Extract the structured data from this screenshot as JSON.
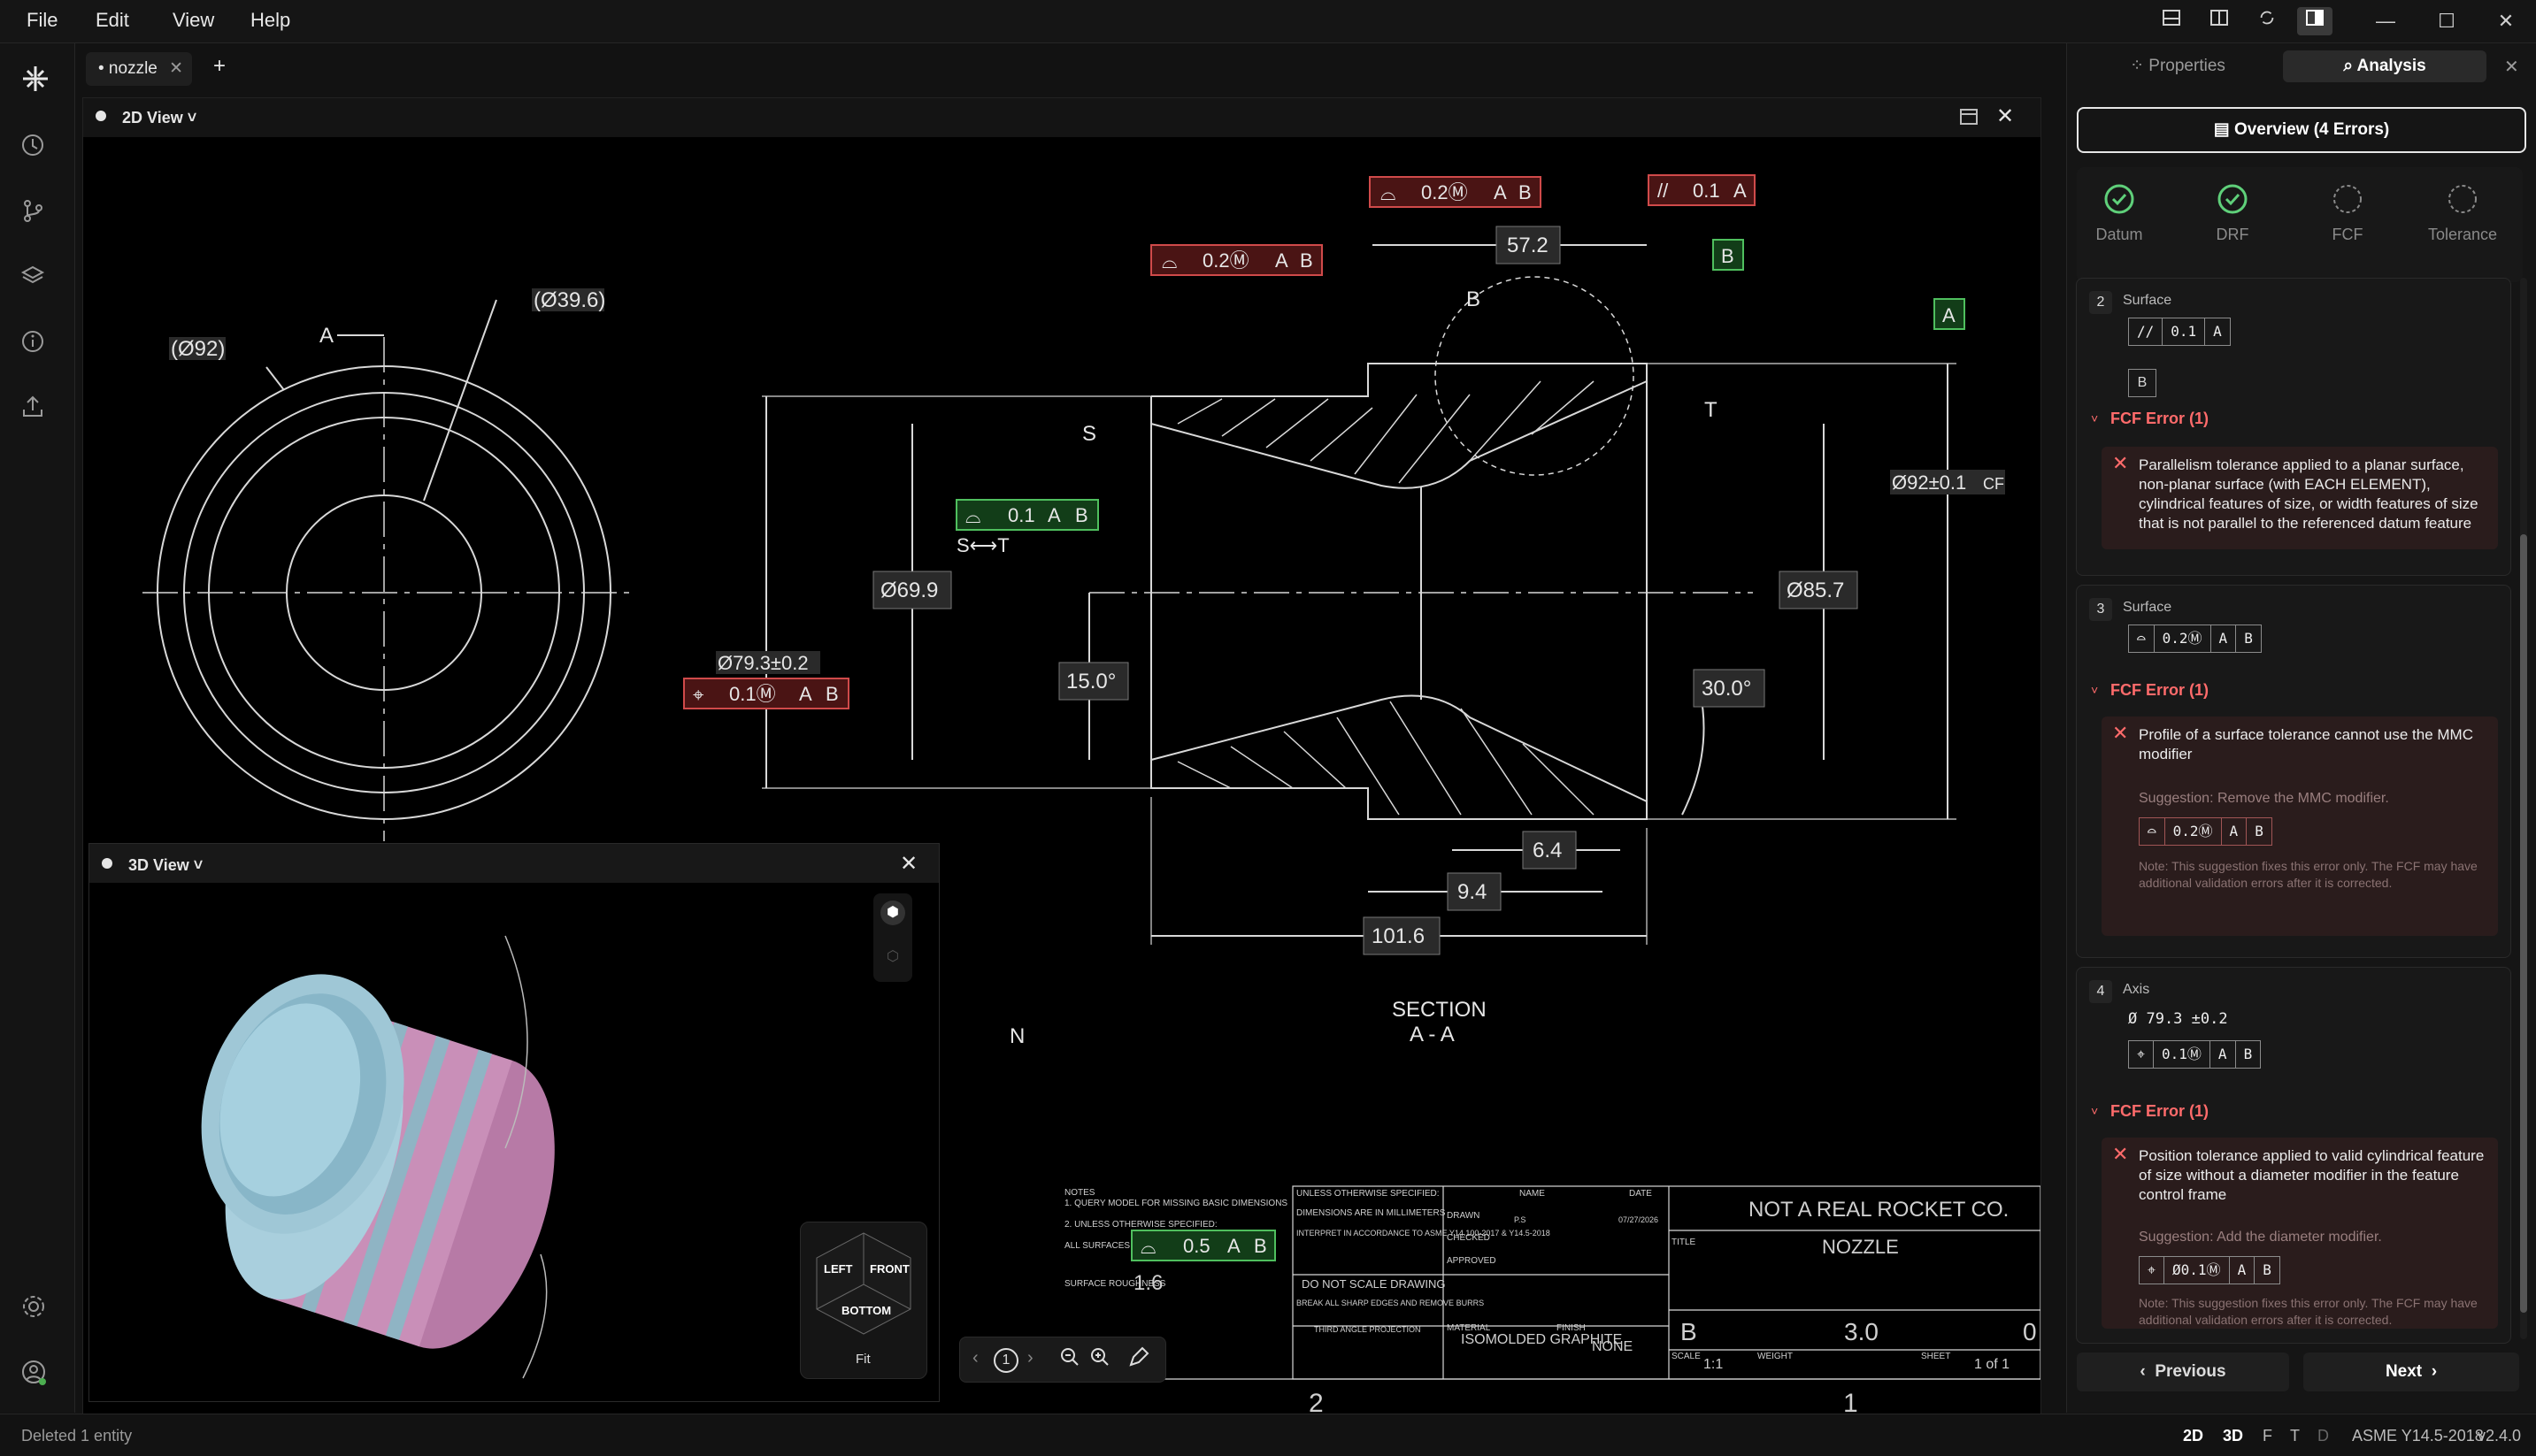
{
  "menu": {
    "file": "File",
    "edit": "Edit",
    "view": "View",
    "help": "Help"
  },
  "tabs": {
    "doc": "• nozzle",
    "add": "+"
  },
  "view2d": {
    "title": "2D View ˅"
  },
  "view3d": {
    "title": "3D View ˅",
    "cube": {
      "left": "LEFT",
      "front": "FRONT",
      "bottom": "BOTTOM",
      "fit": "Fit"
    }
  },
  "drawing": {
    "dims": {
      "d92": "(Ø92)",
      "d396": "(Ø39.6)",
      "a_label": "A",
      "s_label": "S",
      "t_label": "T",
      "b_label": "B",
      "n_label": "N",
      "d699": "Ø69.9",
      "d793": "Ø79.3±0.2",
      "d857": "Ø85.7",
      "d92tol": "Ø92±0.1",
      "cf": "CF",
      "ang15": "15.0°",
      "ang30": "30.0°",
      "d572": "57.2",
      "d64": "6.4",
      "d94": "9.4",
      "d1016": "101.6",
      "st": "S⟷T",
      "section": "SECTION",
      "section_sub": "A - A"
    },
    "fcf_top_left": {
      "tol": "0.2Ⓜ",
      "d1": "A",
      "d2": "B"
    },
    "fcf_top_mid": {
      "tol": "0.2Ⓜ",
      "d1": "A",
      "d2": "B"
    },
    "fcf_top_right": {
      "tol": "0.1",
      "d1": "A"
    },
    "fcf_green": {
      "tol": "0.1",
      "d1": "A",
      "d2": "B"
    },
    "fcf_position": {
      "tol": "0.1Ⓜ",
      "d1": "A",
      "d2": "B"
    },
    "datum_b": "B",
    "datum_a": "A",
    "title_block": {
      "notes_title": "NOTES",
      "note1": "1. QUERY MODEL FOR MISSING BASIC DIMENSIONS",
      "note2": "2. UNLESS OTHERWISE SPECIFIED:",
      "note2b": "ALL SURFACES",
      "surface_roughness": "SURFACE ROUGHNESS",
      "roughness_val": "1.6",
      "fcf_all": {
        "tol": "0.5",
        "d1": "A",
        "d2": "B"
      },
      "unless": "UNLESS OTHERWISE SPECIFIED:",
      "dims_mm": "DIMENSIONS ARE IN MILLIMETERS",
      "interpret": "INTERPRET IN ACCORDANCE TO ASME Y14.100-2017 & Y14.5-2018",
      "do_not_scale": "DO NOT SCALE DRAWING",
      "break_edges": "BREAK ALL SHARP EDGES AND REMOVE BURRS",
      "third_angle": "THIRD ANGLE PROJECTION",
      "name": "NAME",
      "date": "DATE",
      "drawn": "DRAWN",
      "checked": "CHECKED",
      "approved": "APPROVED",
      "drawn_name": "P.S",
      "drawn_date": "07/27/2026",
      "material": "MATERIAL",
      "material_val": "ISOMOLDED GRAPHITE",
      "finish": "FINISH",
      "finish_val": "NONE",
      "company": "NOT A REAL ROCKET CO.",
      "title_lbl": "TITLE",
      "title_val": "NOZZLE",
      "size_val": "B",
      "dwg_no": "3.0",
      "rev_val": "0",
      "scale_lbl": "SCALE",
      "scale_val": "1:1",
      "weight_lbl": "WEIGHT",
      "sheet_lbl": "SHEET",
      "sheet_val": "1 of 1",
      "zone2": "2",
      "zone1": "1"
    },
    "toolbar": {
      "page": "1"
    }
  },
  "right_panel": {
    "tab_properties": "Properties",
    "tab_analysis": "Analysis",
    "overview": "Overview (4 Errors)",
    "status": [
      {
        "label": "Datum",
        "state": "ok"
      },
      {
        "label": "DRF",
        "state": "ok"
      },
      {
        "label": "FCF",
        "state": "pending"
      },
      {
        "label": "Tolerance",
        "state": "pending"
      }
    ],
    "cards": [
      {
        "index": "2",
        "type": "Surface",
        "fcf": {
          "sym": "//",
          "tol": "0.1",
          "d1": "A"
        },
        "datum": "B",
        "error_title": "FCF Error (1)",
        "error_text": "Parallelism tolerance applied to a planar surface, non-planar surface (with EACH ELEMENT), cylindrical features of size, or width features of size that is not parallel to the referenced datum feature"
      },
      {
        "index": "3",
        "type": "Surface",
        "fcf": {
          "tol": "0.2Ⓜ",
          "d1": "A",
          "d2": "B"
        },
        "error_title": "FCF Error (1)",
        "error_text": "Profile of a surface tolerance cannot use the MMC modifier",
        "suggestion": "Suggestion: Remove the MMC modifier.",
        "sugg_fcf": {
          "tol": "0.2Ⓜ",
          "d1": "A",
          "d2": "B"
        },
        "note": "Note: This suggestion fixes this error only. The FCF may have additional validation errors after it is corrected."
      },
      {
        "index": "4",
        "type": "Axis",
        "size": "Ø 79.3 ±0.2",
        "fcf": {
          "tol": "0.1Ⓜ",
          "d1": "A",
          "d2": "B"
        },
        "error_title": "FCF Error (1)",
        "error_text": "Position tolerance applied to valid cylindrical feature of size without a diameter modifier in the feature control frame",
        "suggestion": "Suggestion: Add the diameter modifier.",
        "sugg_fcf": {
          "tol": "Ø0.1Ⓜ",
          "d1": "A",
          "d2": "B"
        },
        "note": "Note: This suggestion fixes this error only. The FCF may have additional validation errors after it is corrected."
      }
    ],
    "previous": "Previous",
    "next": "Next"
  },
  "status_bar": {
    "message": "Deleted 1 entity",
    "mode2d": "2D",
    "mode3d": "3D",
    "f": "F",
    "t": "T",
    "d": "D",
    "standard": "ASME Y14.5-2018",
    "version": "v2.4.0"
  },
  "colors": {
    "accent_green": "#5fd07a",
    "error_red": "#ff6b6b",
    "fcf_red_bg": "#6b2222",
    "fcf_green_bg": "#1d4d23",
    "part_blue": "#9fc7d6",
    "part_pink": "#c98fb8"
  }
}
